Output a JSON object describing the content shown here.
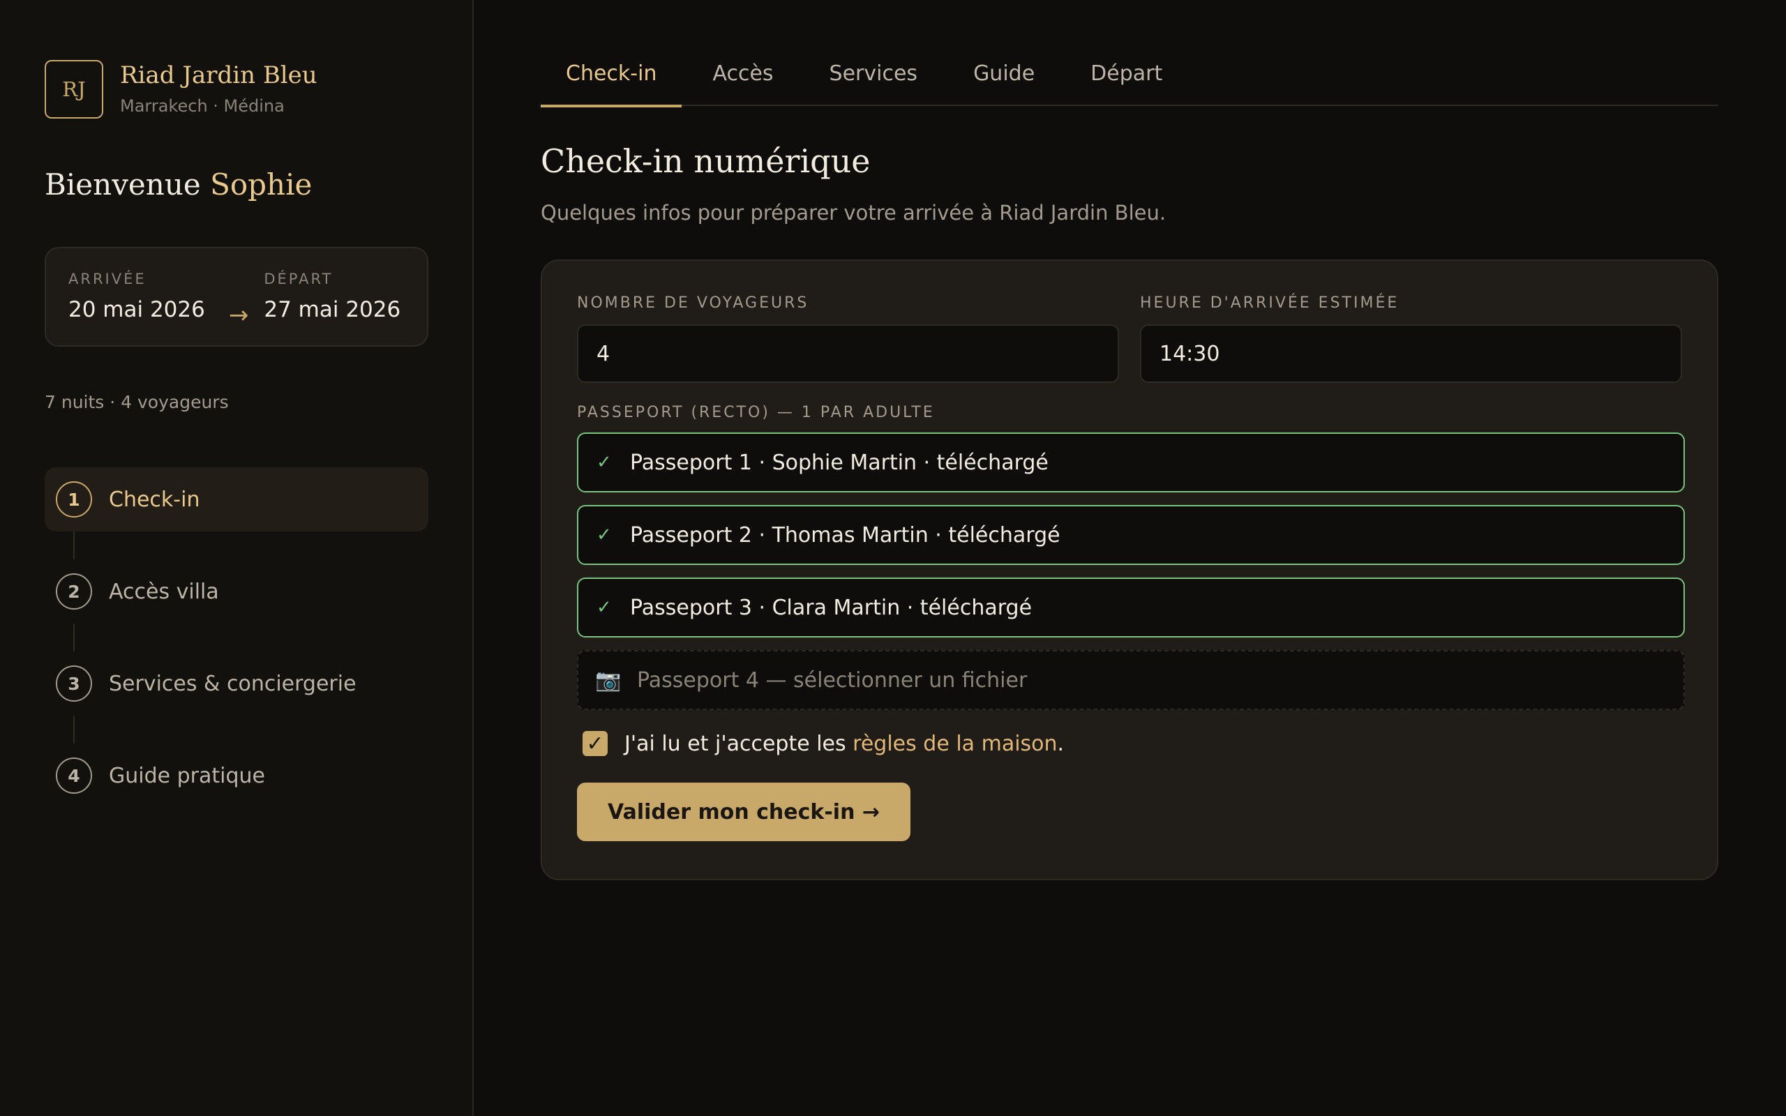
{
  "brand": {
    "monogram": "RJ",
    "name": "Riad Jardin Bleu",
    "location": "Marrakech · Médina"
  },
  "welcome": {
    "prefix": "Bienvenue",
    "guest_name": "Sophie"
  },
  "stay": {
    "arrival_label": "ARRIVÉE",
    "arrival_date": "20 mai 2026",
    "arrow": "→",
    "departure_label": "DÉPART",
    "departure_date": "27 mai 2026",
    "summary": "7 nuits · 4 voyageurs"
  },
  "steps": [
    {
      "number": "1",
      "label": "Check-in",
      "active": true
    },
    {
      "number": "2",
      "label": "Accès villa",
      "active": false
    },
    {
      "number": "3",
      "label": "Services & conciergerie",
      "active": false
    },
    {
      "number": "4",
      "label": "Guide pratique",
      "active": false
    }
  ],
  "tabs": [
    {
      "label": "Check-in",
      "active": true
    },
    {
      "label": "Accès",
      "active": false
    },
    {
      "label": "Services",
      "active": false
    },
    {
      "label": "Guide",
      "active": false
    },
    {
      "label": "Départ",
      "active": false
    }
  ],
  "page": {
    "title": "Check-in numérique",
    "subtitle": "Quelques infos pour préparer votre arrivée à Riad Jardin Bleu."
  },
  "form": {
    "travelers_label": "NOMBRE DE VOYAGEURS",
    "travelers_value": "4",
    "arrival_time_label": "HEURE D'ARRIVÉE ESTIMÉE",
    "arrival_time_value": "14:30",
    "passport_label": "PASSEPORT (RECTO) — 1 PAR ADULTE",
    "passports_uploaded": [
      {
        "check": "✓",
        "text": "Passeport 1 · Sophie Martin · téléchargé"
      },
      {
        "check": "✓",
        "text": "Passeport 2 · Thomas Martin · téléchargé"
      },
      {
        "check": "✓",
        "text": "Passeport 3 · Clara Martin · téléchargé"
      }
    ],
    "passport_pending": {
      "icon": "📷",
      "text": "Passeport 4 — sélectionner un fichier"
    },
    "agree_checked": true,
    "agree_mark": "✓",
    "agree_text": "J'ai lu et j'accepte les ",
    "agree_link": "règles de la maison",
    "agree_end": ".",
    "submit_label": "Valider mon check-in →"
  },
  "colors": {
    "accent": "#c9a96a",
    "accent_light": "#e9c98d",
    "success": "#7bc47f",
    "background": "#0e0d0b"
  }
}
